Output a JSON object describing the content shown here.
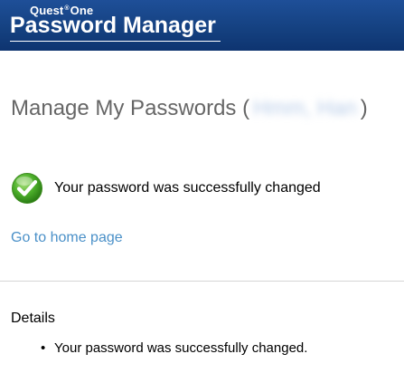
{
  "header": {
    "brand_top": "Quest",
    "brand_reg": "®",
    "brand_top_suffix": "One",
    "brand_main": "Password Manager",
    "bg_color": "#14407f"
  },
  "main": {
    "title_prefix": "Manage My Passwords (",
    "title_user": "Hmm, Han",
    "title_suffix": ")",
    "success_message": "Your password was successfully changed",
    "success_icon": "check-circle-icon",
    "home_link": "Go to home page",
    "link_color": "#4a90c8"
  },
  "details": {
    "heading": "Details",
    "items": [
      "Your password was successfully changed."
    ]
  }
}
